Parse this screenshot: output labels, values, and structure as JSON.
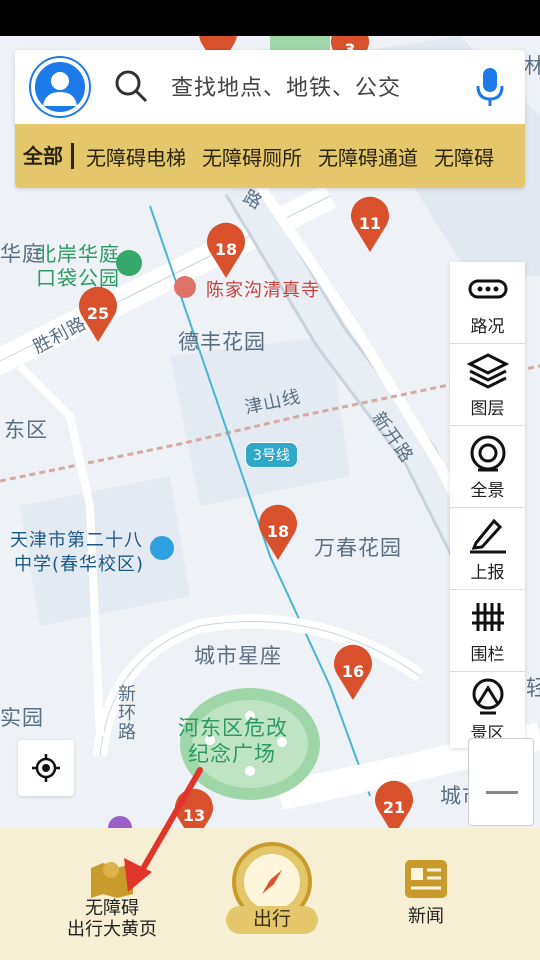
{
  "search": {
    "placeholder": "查找地点、地铁、公交"
  },
  "filters": {
    "active": "全部",
    "items": [
      "无障碍电梯",
      "无障碍厕所",
      "无障碍通道",
      "无障碍"
    ]
  },
  "map": {
    "labels": {
      "beian": "北岸华庭",
      "koudai": "口袋公园",
      "chenjia": "陈家沟清真寺",
      "defeng": "德丰花园",
      "shengli_road": "胜利路",
      "dongqu": "东区",
      "jinshan_line": "津山线",
      "xinkai_road": "新开路",
      "school_1": "天津市第二十八",
      "school_2": "中学(春华校区)",
      "wanchun": "万春花园",
      "chengshi": "城市星座",
      "xinhuan_road": "新环路",
      "shiyuan": "实园",
      "weigai_1": "河东区危改",
      "weigai_2": "纪念广场",
      "lu_top": "路",
      "ting_left": "华庭",
      "cheng_right": "城市",
      "lin": "林",
      "zhu_right": "轻"
    },
    "metro_badge": "3号线",
    "markers": [
      "3",
      "11",
      "18",
      "25",
      "18",
      "16",
      "21",
      "13"
    ]
  },
  "toolbar": {
    "items": [
      {
        "label": "路况",
        "icon": "traffic-icon"
      },
      {
        "label": "图层",
        "icon": "layers-icon"
      },
      {
        "label": "全景",
        "icon": "panorama-icon"
      },
      {
        "label": "上报",
        "icon": "report-icon"
      },
      {
        "label": "围栏",
        "icon": "fence-icon"
      },
      {
        "label": "景区",
        "icon": "scenic-icon"
      }
    ]
  },
  "bottom_nav": {
    "yellow_pages_line1": "无障碍",
    "yellow_pages_line2": "出行大黄页",
    "travel": "出行",
    "news": "新闻"
  },
  "colors": {
    "marker": "#d9502c",
    "filter_bar": "#e5c76b",
    "avatar": "#1d7ae8",
    "bottom_nav": "#f7efd3",
    "annotation_arrow": "#e0352b"
  }
}
